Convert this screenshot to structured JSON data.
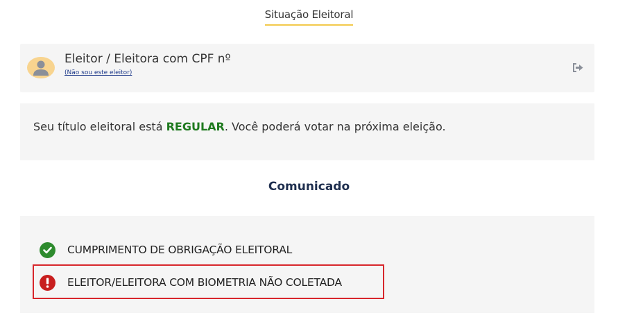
{
  "header": {
    "title": "Situação Eleitoral"
  },
  "voter": {
    "title": "Eleitor / Eleitora com CPF nº",
    "not_me_link": "(Não sou este eleitor)",
    "avatar_icon": "user-avatar-icon",
    "logout_icon": "logout-icon"
  },
  "status": {
    "prefix": "Seu título eleitoral está ",
    "highlight": "REGULAR",
    "suffix": ". Você poderá votar na próxima eleição.",
    "highlight_color": "#1f7a1f"
  },
  "comunicado": {
    "title": "Comunicado",
    "items": [
      {
        "label": "CUMPRIMENTO DE OBRIGAÇÃO ELEITORAL",
        "icon": "check-circle-icon",
        "color": "#2e8b2e"
      },
      {
        "label": "ELEITOR/ELEITORA COM BIOMETRIA NÃO COLETADA",
        "icon": "alert-circle-icon",
        "color": "#c81e1e"
      }
    ]
  },
  "colors": {
    "accent_underline": "#f2c94c",
    "highlight_box": "#d7262b",
    "card_background": "#f5f5f5"
  }
}
